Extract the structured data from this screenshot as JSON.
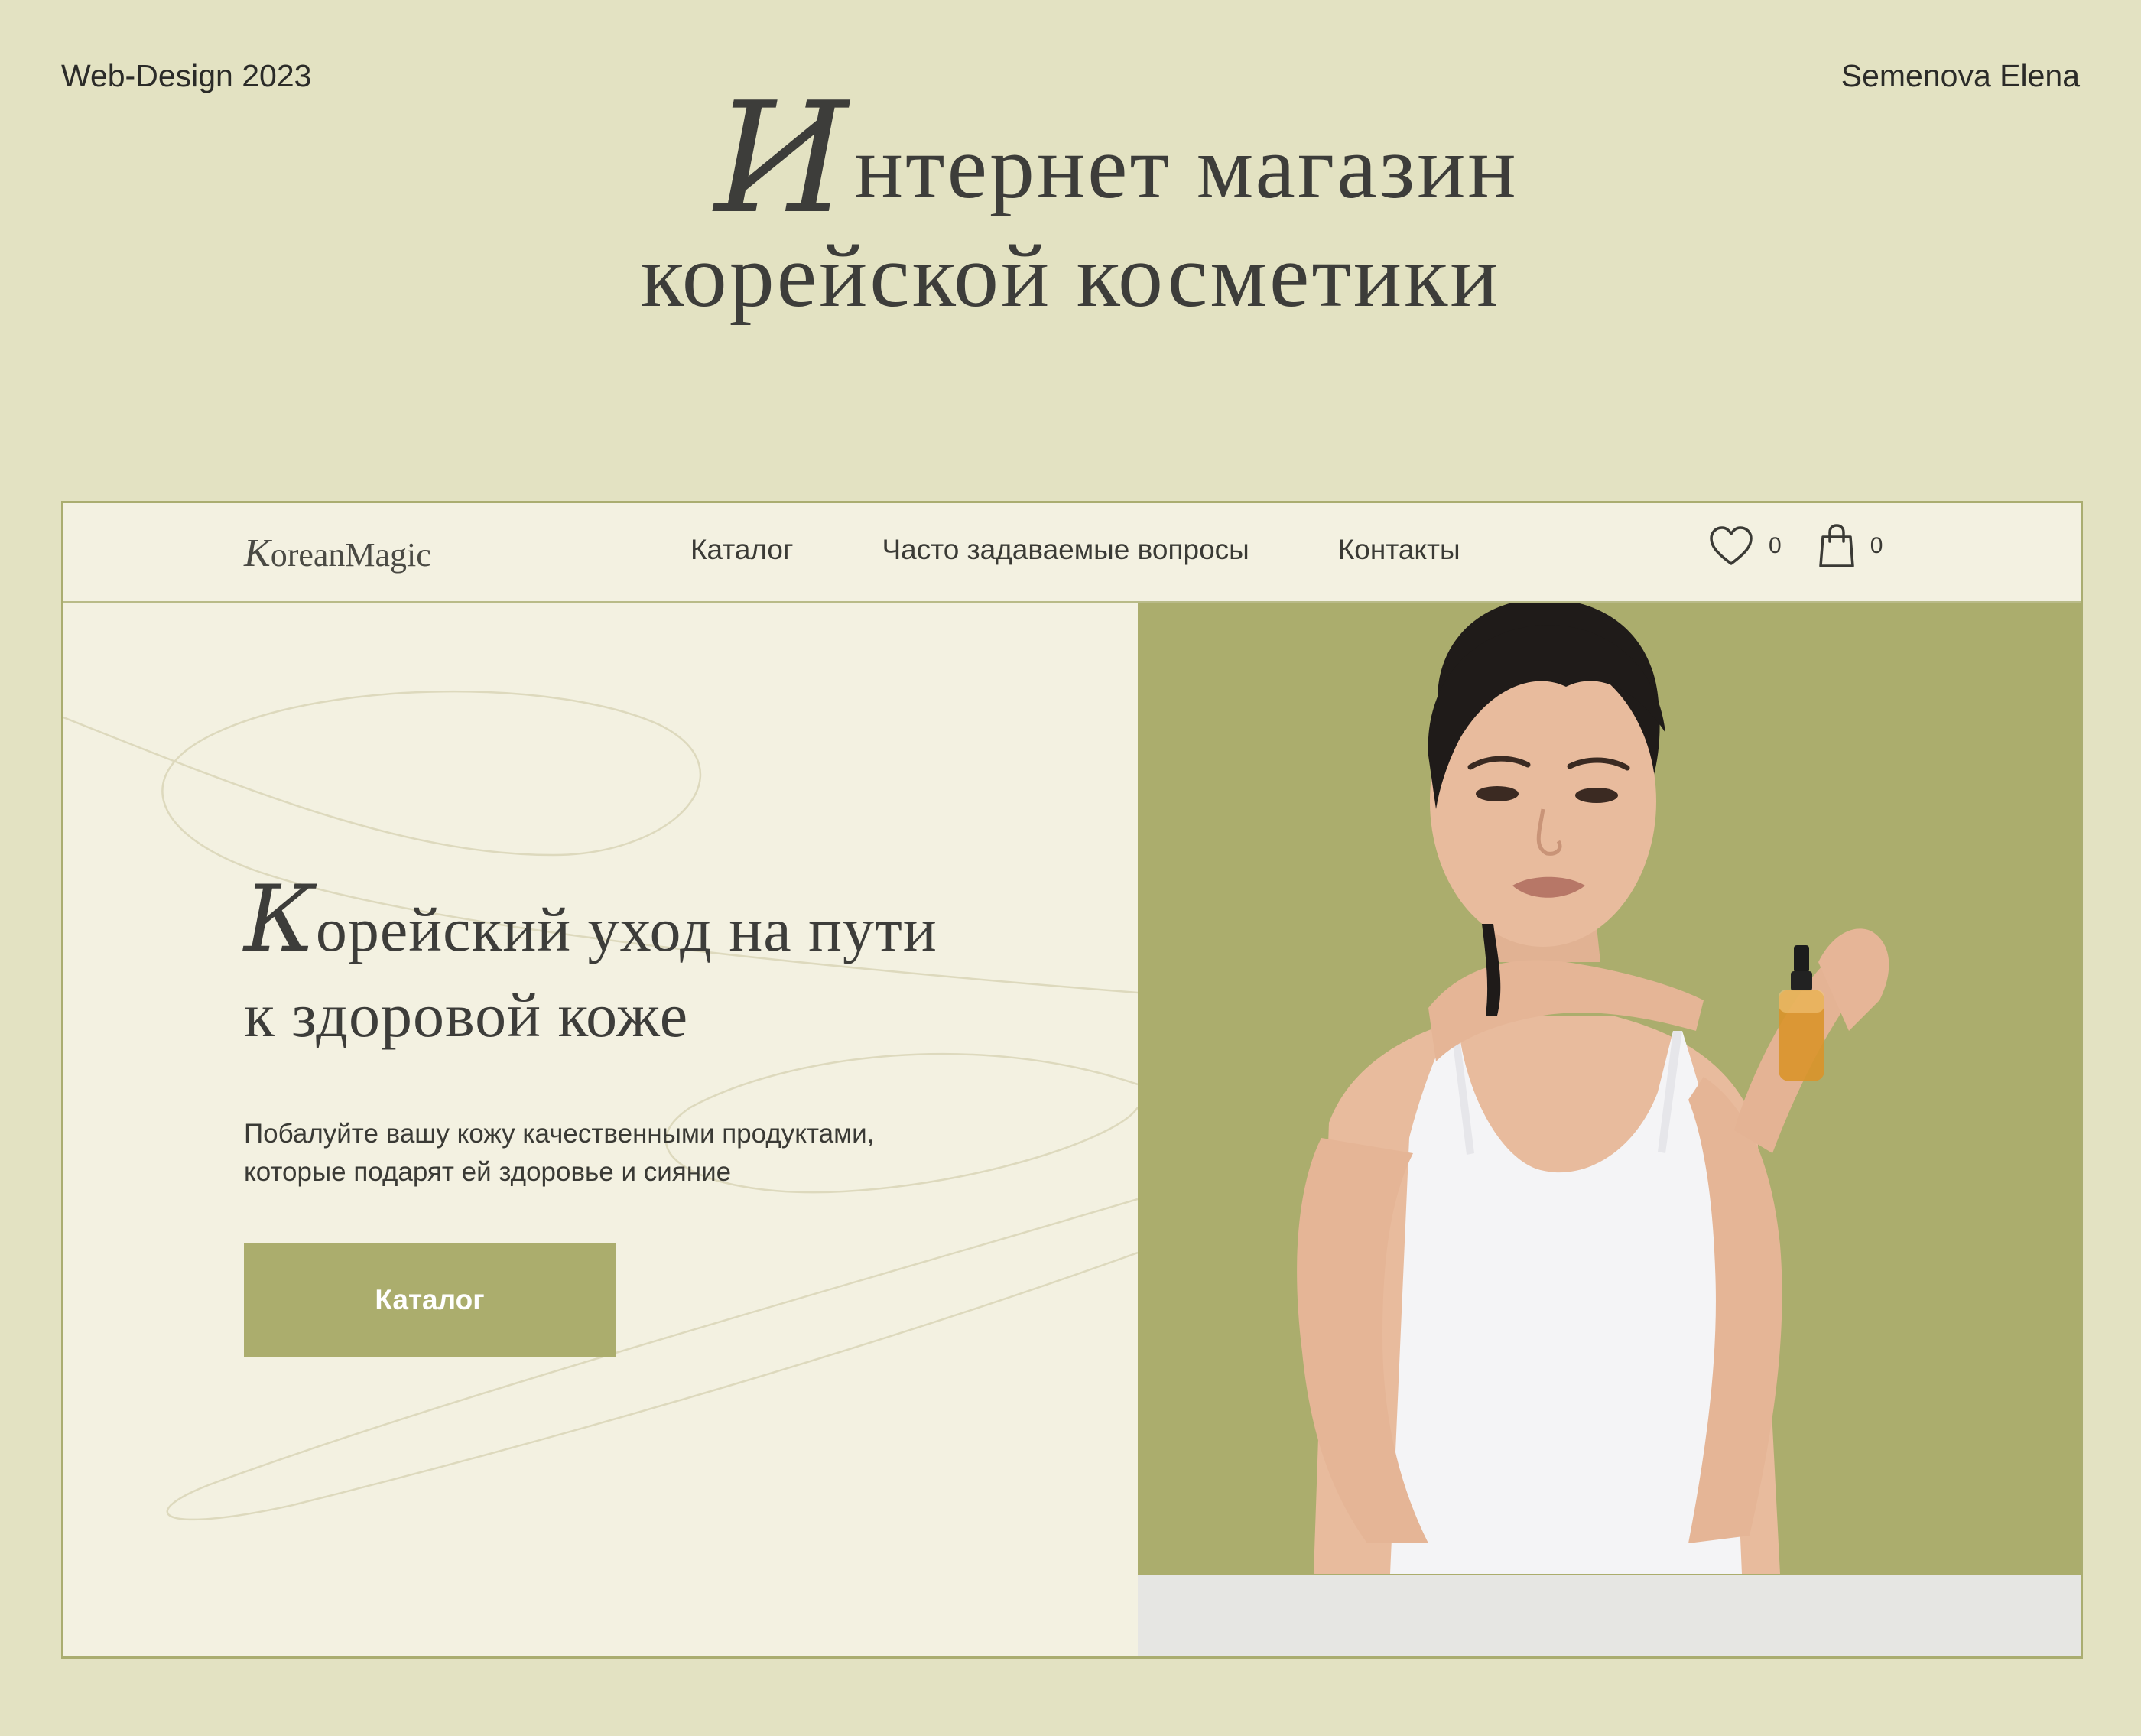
{
  "header": {
    "left_label": "Web-Design 2023",
    "right_label": "Semenova Elena",
    "title_initial": "И",
    "title_line1_rest": "нтернет магазин",
    "title_line2": "корейской косметики"
  },
  "site": {
    "logo_initial": "K",
    "logo_rest": "oreanMagic",
    "nav": [
      "Каталог",
      "Часто задаваемые вопросы",
      "Контакты"
    ],
    "wishlist_count": "0",
    "cart_count": "0",
    "hero": {
      "title_initial": "К",
      "title_line1_rest": "орейский уход на пути",
      "title_line2": "к здоровой коже",
      "subtitle_line1": "Побалуйте вашу кожу качественными продуктами,",
      "subtitle_line2": "которые подарят ей здоровье и сияние",
      "cta_label": "Каталог"
    }
  },
  "colors": {
    "page_background": "#e3e2c2",
    "mockup_background": "#f3f1e1",
    "accent_olive": "#abad6d",
    "text_dark": "#3a3a35"
  },
  "icons": [
    "heart-icon",
    "shopping-bag-icon"
  ]
}
